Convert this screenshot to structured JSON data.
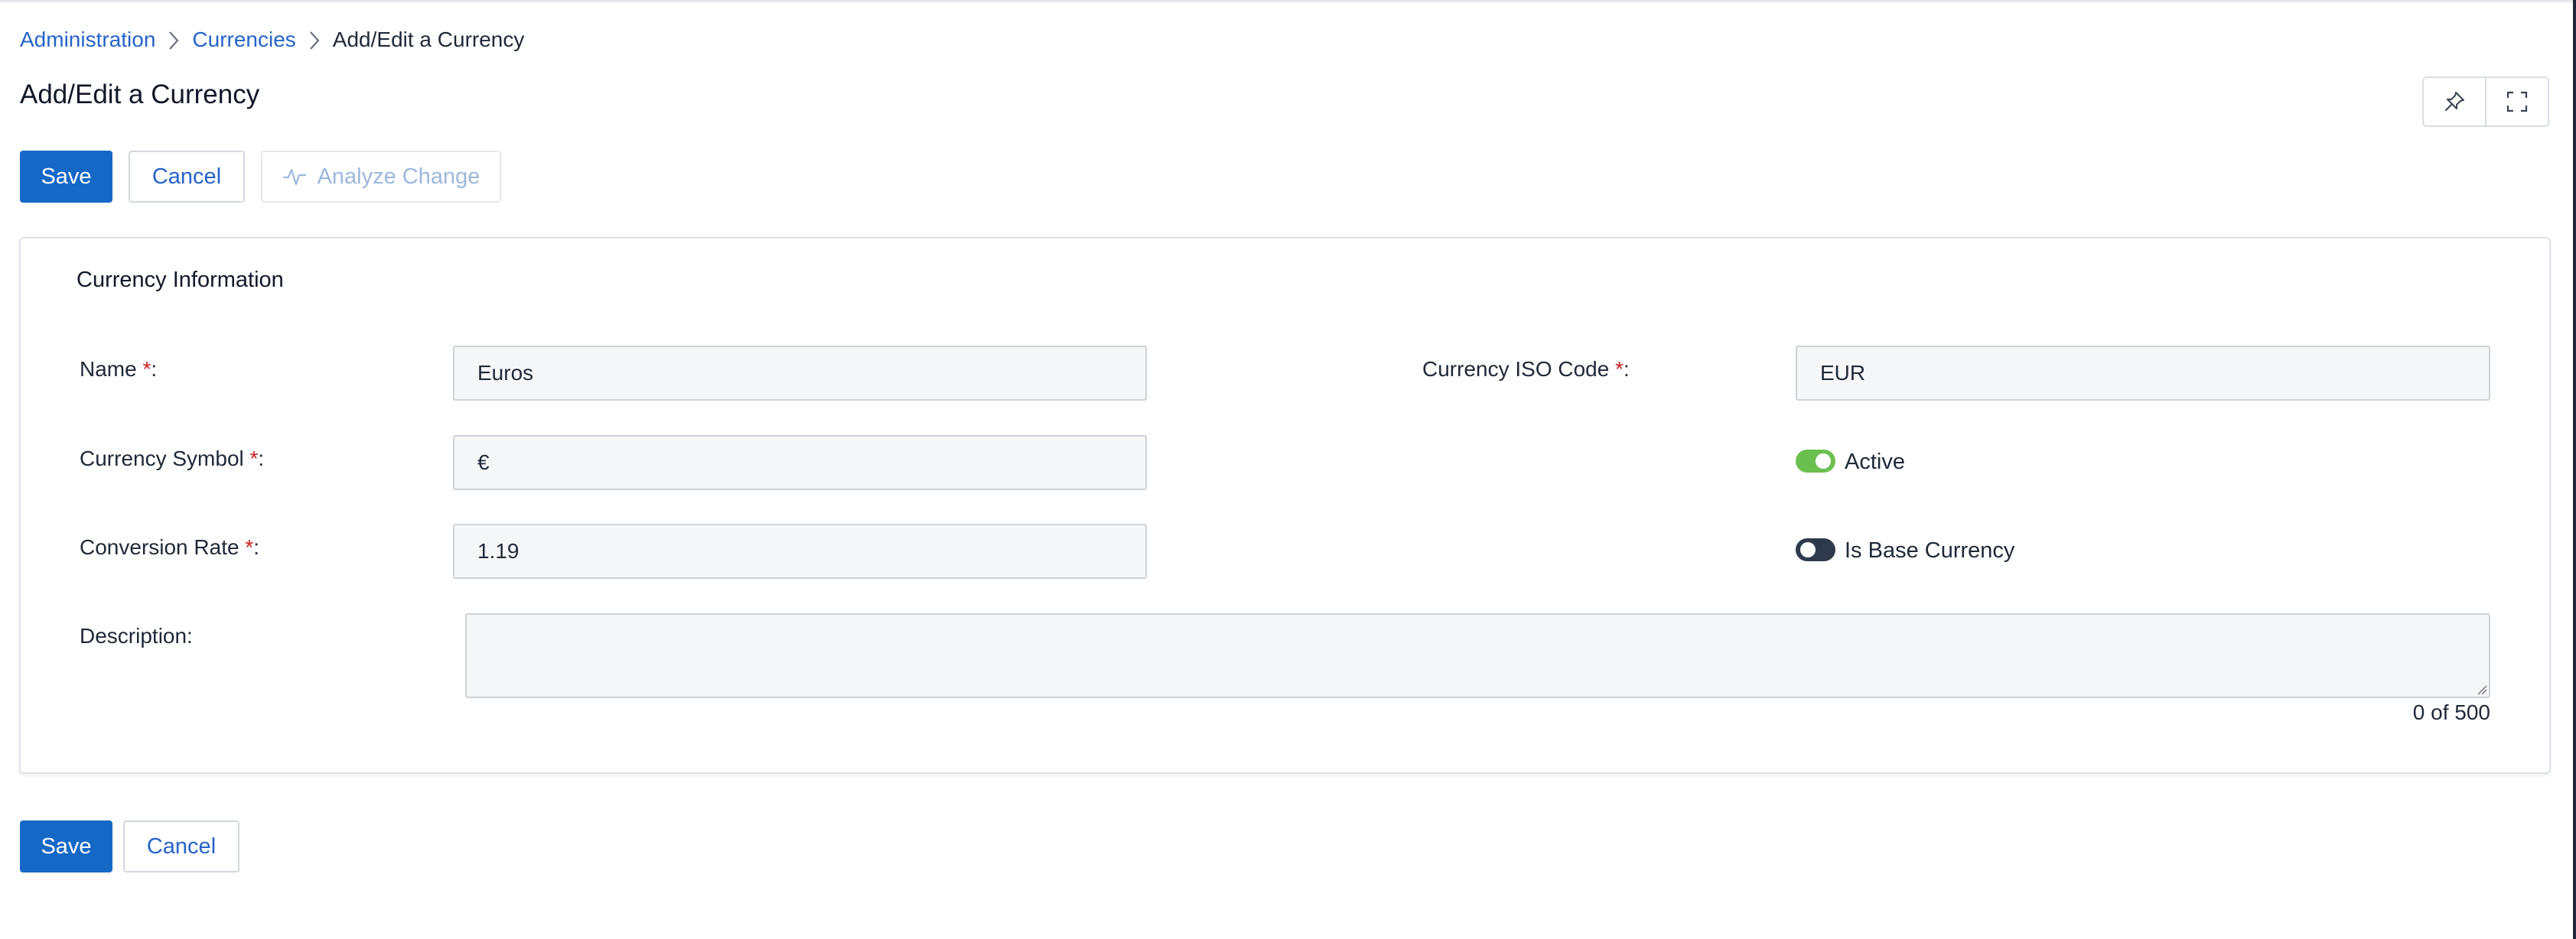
{
  "breadcrumb": {
    "items": [
      "Administration",
      "Currencies"
    ],
    "current": "Add/Edit a Currency"
  },
  "page": {
    "title": "Add/Edit a Currency"
  },
  "toolbar": {
    "save_label": "Save",
    "cancel_label": "Cancel",
    "analyze_label": "Analyze Change"
  },
  "view_tools": {
    "icons": [
      "pin-icon",
      "fullscreen-icon"
    ]
  },
  "form": {
    "section_title": "Currency Information",
    "required_mark": "*",
    "name": {
      "label": "Name",
      "value": "Euros"
    },
    "iso_code": {
      "label": "Currency ISO Code",
      "value": "EUR"
    },
    "symbol": {
      "label": "Currency Symbol",
      "value": "€"
    },
    "conversion_rate": {
      "label": "Conversion Rate ",
      "value": "1.19"
    },
    "active": {
      "label": "Active",
      "on": true
    },
    "base_currency": {
      "label": "Is Base Currency",
      "on": false
    },
    "description": {
      "label": "Description:",
      "value": "",
      "counter": "0 of 500"
    }
  },
  "footer": {
    "save_label": "Save",
    "cancel_label": "Cancel"
  },
  "colors": {
    "primary": "#1668c6",
    "link": "#2563c8",
    "required": "#c81e1e",
    "toggle_on": "#6bbf4f",
    "toggle_off": "#2e3a4b"
  }
}
